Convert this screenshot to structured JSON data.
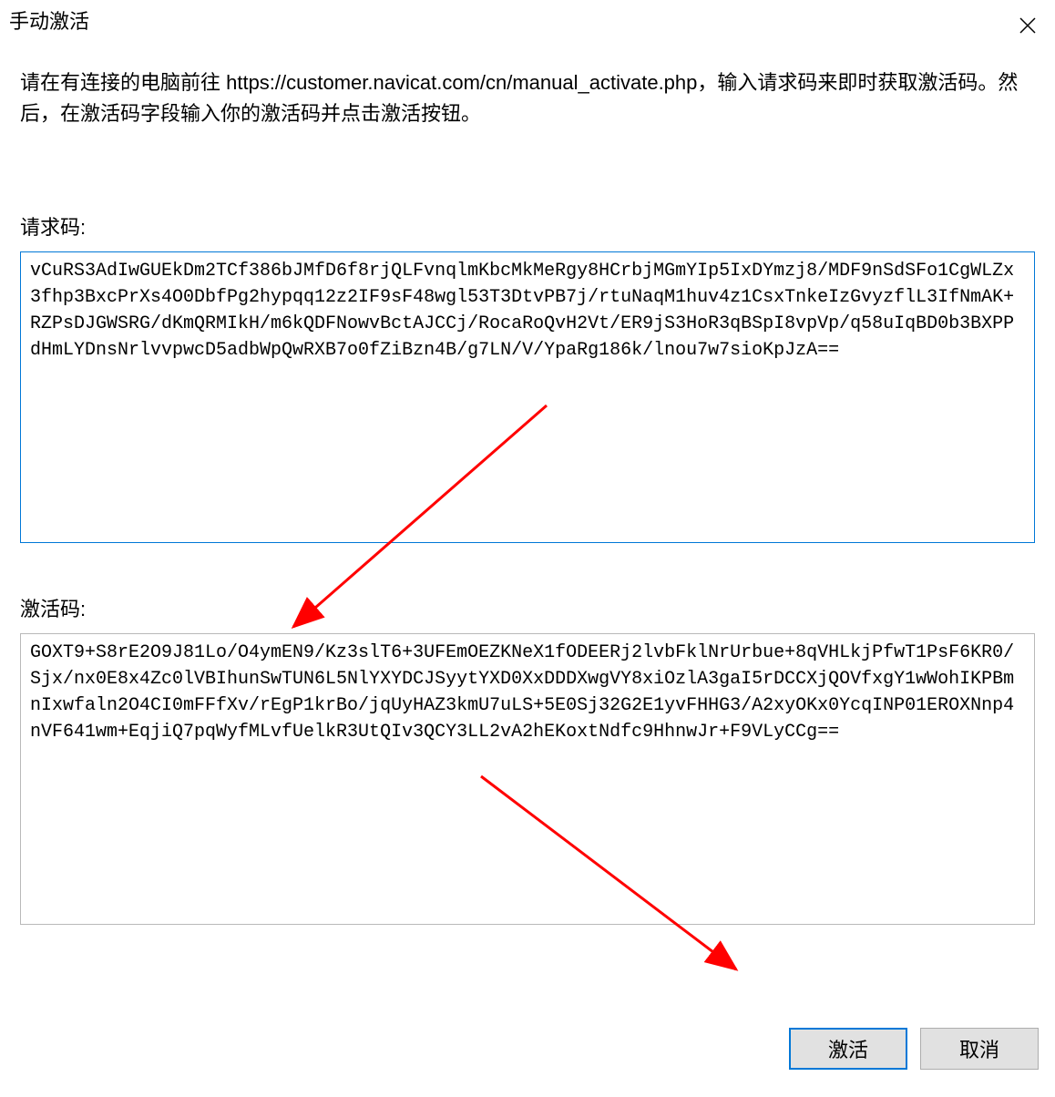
{
  "window": {
    "title": "手动激活"
  },
  "instructions": "请在有连接的电脑前往 https://customer.navicat.com/cn/manual_activate.php，输入请求码来即时获取激活码。然后，在激活码字段输入你的激活码并点击激活按钮。",
  "labels": {
    "request_code": "请求码:",
    "activation_code": "激活码:"
  },
  "request_code_value": "vCuRS3AdIwGUEkDm2TCf386bJMfD6f8rjQLFvnqlmKbcMkMeRgy8HCrbjMGmYIp5IxDYmzj8/MDF9nSdSFo1CgWLZx3fhp3BxcPrXs4O0DbfPg2hypqq12z2IF9sF48wgl53T3DtvPB7j/rtuNaqM1huv4z1CsxTnkeIzGvyzflL3IfNmAK+RZPsDJGWSRG/dKmQRMIkH/m6kQDFNowvBctAJCCj/RocaRoQvH2Vt/ER9jS3HoR3qBSpI8vpVp/q58uIqBD0b3BXPPdHmLYDnsNrlvvpwcD5adbWpQwRXB7o0fZiBzn4B/g7LN/V/YpaRg186k/lnou7w7sioKpJzA==",
  "activation_code_value": "GOXT9+S8rE2O9J81Lo/O4ymEN9/Kz3slT6+3UFEmOEZKNeX1fODEERj2lvbFklNrUrbue+8qVHLkjPfwT1PsF6KR0/Sjx/nx0E8x4Zc0lVBIhunSwTUN6L5NlYXYDCJSyytYXD0XxDDDXwgVY8xiOzlA3gaI5rDCCXjQOVfxgY1wWohIKPBmnIxwfaln2O4CI0mFFfXv/rEgP1krBo/jqUyHAZ3kmU7uLS+5E0Sj32G2E1yvFHHG3/A2xyOKx0YcqINP01EROXNnp4nVF641wm+EqjiQ7pqWyfMLvfUelkR3UtQIv3QCY3LL2vA2hEKoxtNdfc9HhnwJr+F9VLyCCg==",
  "buttons": {
    "activate": "激活",
    "cancel": "取消"
  }
}
